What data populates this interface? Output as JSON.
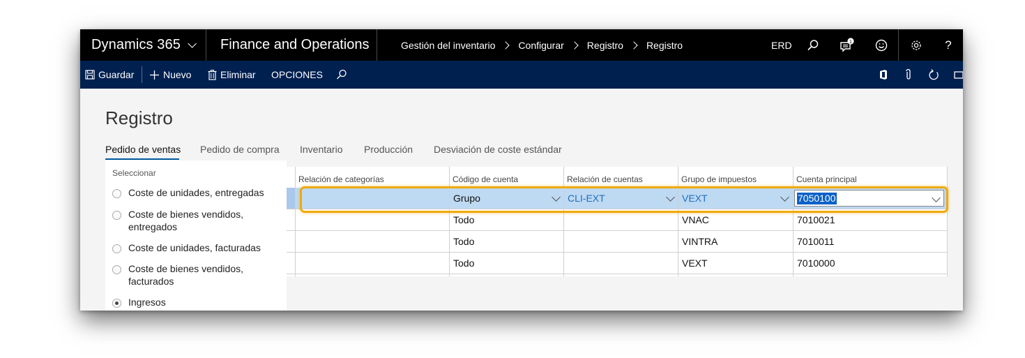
{
  "topbar": {
    "brand": "Dynamics 365",
    "app_name": "Finance and Operations",
    "breadcrumbs": [
      "Gestión del inventario",
      "Configurar",
      "Registro",
      "Registro"
    ],
    "company": "ERD",
    "notification_count": "1",
    "icons": [
      "search-icon",
      "notifications-icon",
      "feedback-smiley-icon",
      "settings-gear-icon",
      "help-icon"
    ]
  },
  "actionbar": {
    "save": "Guardar",
    "new": "Nuevo",
    "delete": "Eliminar",
    "options": "OPCIONES",
    "icons": [
      "save-icon",
      "plus-icon",
      "trash-icon",
      "search-icon",
      "office-icon",
      "attachment-icon",
      "refresh-icon",
      "open-new-icon"
    ]
  },
  "page": {
    "title": "Registro",
    "tabs": [
      {
        "label": "Pedido de ventas",
        "active": true
      },
      {
        "label": "Pedido de compra",
        "active": false
      },
      {
        "label": "Inventario",
        "active": false
      },
      {
        "label": "Producción",
        "active": false
      },
      {
        "label": "Desviación de coste estándar",
        "active": false
      }
    ]
  },
  "select_panel": {
    "title": "Seleccionar",
    "options": [
      {
        "label": "Coste de unidades, entregadas",
        "checked": false
      },
      {
        "label": "Coste de bienes vendidos, entregados",
        "checked": false
      },
      {
        "label": "Coste de unidades, facturadas",
        "checked": false
      },
      {
        "label": "Coste de bienes vendidos, facturados",
        "checked": false
      },
      {
        "label": "Ingresos",
        "checked": true
      }
    ]
  },
  "grid": {
    "columns": [
      "Relación de categorías",
      "Código de cuenta",
      "Relación de cuentas",
      "Grupo de impuestos",
      "Cuenta principal"
    ],
    "rows": [
      [
        "",
        "Grupo",
        "CLI-EXT",
        "VEXT",
        "7050100"
      ],
      [
        "",
        "Todo",
        "",
        "VNAC",
        "7010021"
      ],
      [
        "",
        "Todo",
        "",
        "VINTRA",
        "7010011"
      ],
      [
        "",
        "Todo",
        "",
        "VEXT",
        "7010000"
      ]
    ]
  },
  "colors": {
    "topbar_bg": "#000000",
    "actionbar_bg": "#002050",
    "selected_row": "#bed9f2",
    "highlight_frame": "#f0a90b",
    "link_text": "#1e6fbf"
  }
}
